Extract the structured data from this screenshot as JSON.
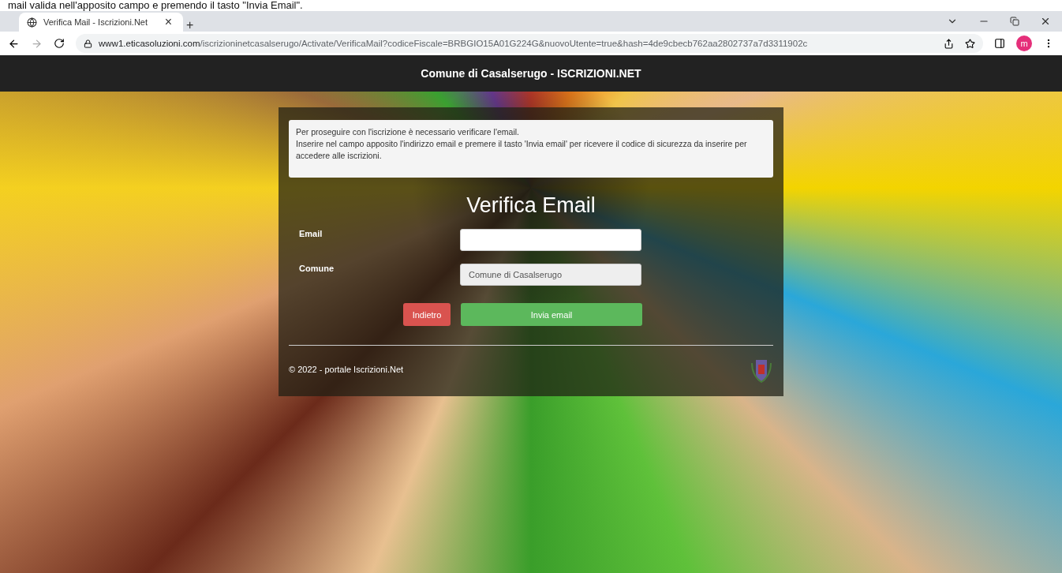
{
  "caption": "mail valida nell'apposito campo e premendo il tasto \"Invia Email\".",
  "browser": {
    "tab": {
      "title": "Verifica Mail - Iscrizioni.Net",
      "close": "×"
    },
    "new_tab": "+",
    "url_host": "www1.eticasoluzioni.com",
    "url_path": "/iscrizioninetcasalserugo/Activate/VerificaMail?codiceFiscale=BRBGIO15A01G224G&nuovoUtente=true&hash=4de9cbecb762aa2802737a7d3311902c",
    "profile": "m"
  },
  "header": {
    "title": "Comune di Casalserugo - ISCRIZIONI.NET"
  },
  "notice": [
    "Per proseguire con l'iscrizione è necessario verificare l'email.",
    "Inserire nel campo apposito l'indirizzo email e premere il tasto 'Invia email' per ricevere il codice di sicurezza da inserire per accedere alle iscrizioni."
  ],
  "form": {
    "title": "Verifica Email",
    "fields": [
      {
        "label": "Email",
        "disabled": false
      },
      {
        "label": "Comune",
        "value": "Comune di Casalserugo",
        "disabled": true
      }
    ],
    "buttons": [
      {
        "kind": "back",
        "label": "Indietro"
      },
      {
        "kind": "submit",
        "label": "Invia email"
      }
    ]
  },
  "footer": {
    "copyright": "© 2022 - portale Iscrizioni.Net"
  }
}
